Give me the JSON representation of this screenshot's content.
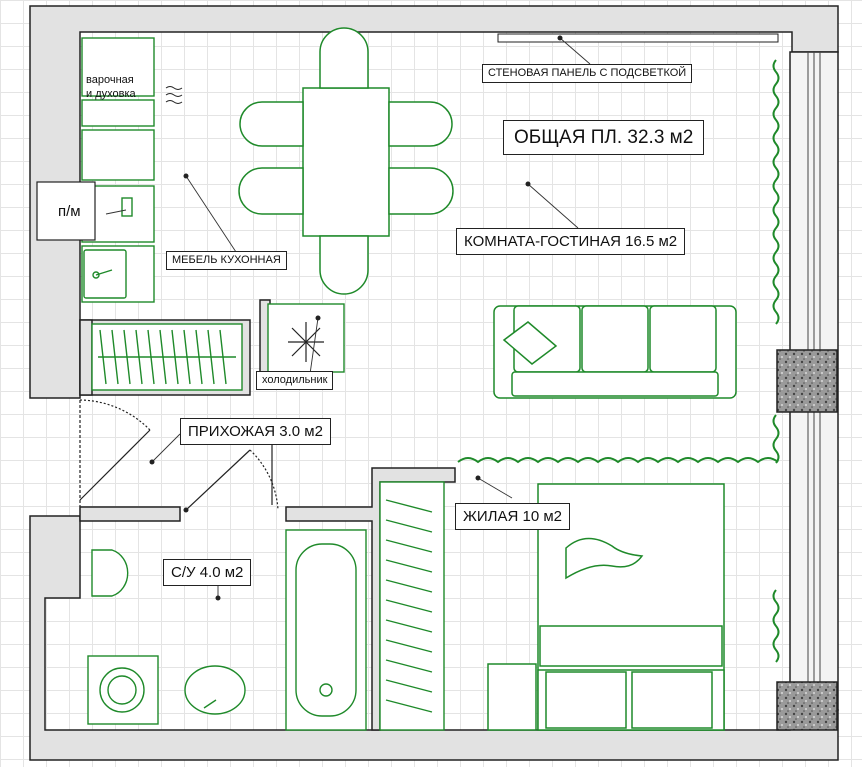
{
  "plan": {
    "total_area": "ОБЩАЯ ПЛ. 32.3 м2",
    "rooms": {
      "living_room": "КОМНАТА-ГОСТИНАЯ 16.5 м2",
      "hallway": "ПРИХОЖАЯ 3.0 м2",
      "bedroom": "ЖИЛАЯ 10 м2",
      "bathroom": "С/У 4.0 м2"
    },
    "annotations": {
      "wall_panel": "СТЕНОВАЯ ПАНЕЛЬ С ПОДСВЕТКОЙ",
      "kitchen_furniture": "МЕБЕЛЬ КУХОННАЯ",
      "fridge": "холодильник",
      "dishwasher": "п/м",
      "hob_line1": "варочная",
      "hob_line2": "и духовка"
    }
  },
  "colors": {
    "wall": "#e2e2e2",
    "outline": "#222222",
    "furniture": "#1f8a2a",
    "column_fill": "#8f8f8f",
    "grid": "#e4e4e4"
  }
}
